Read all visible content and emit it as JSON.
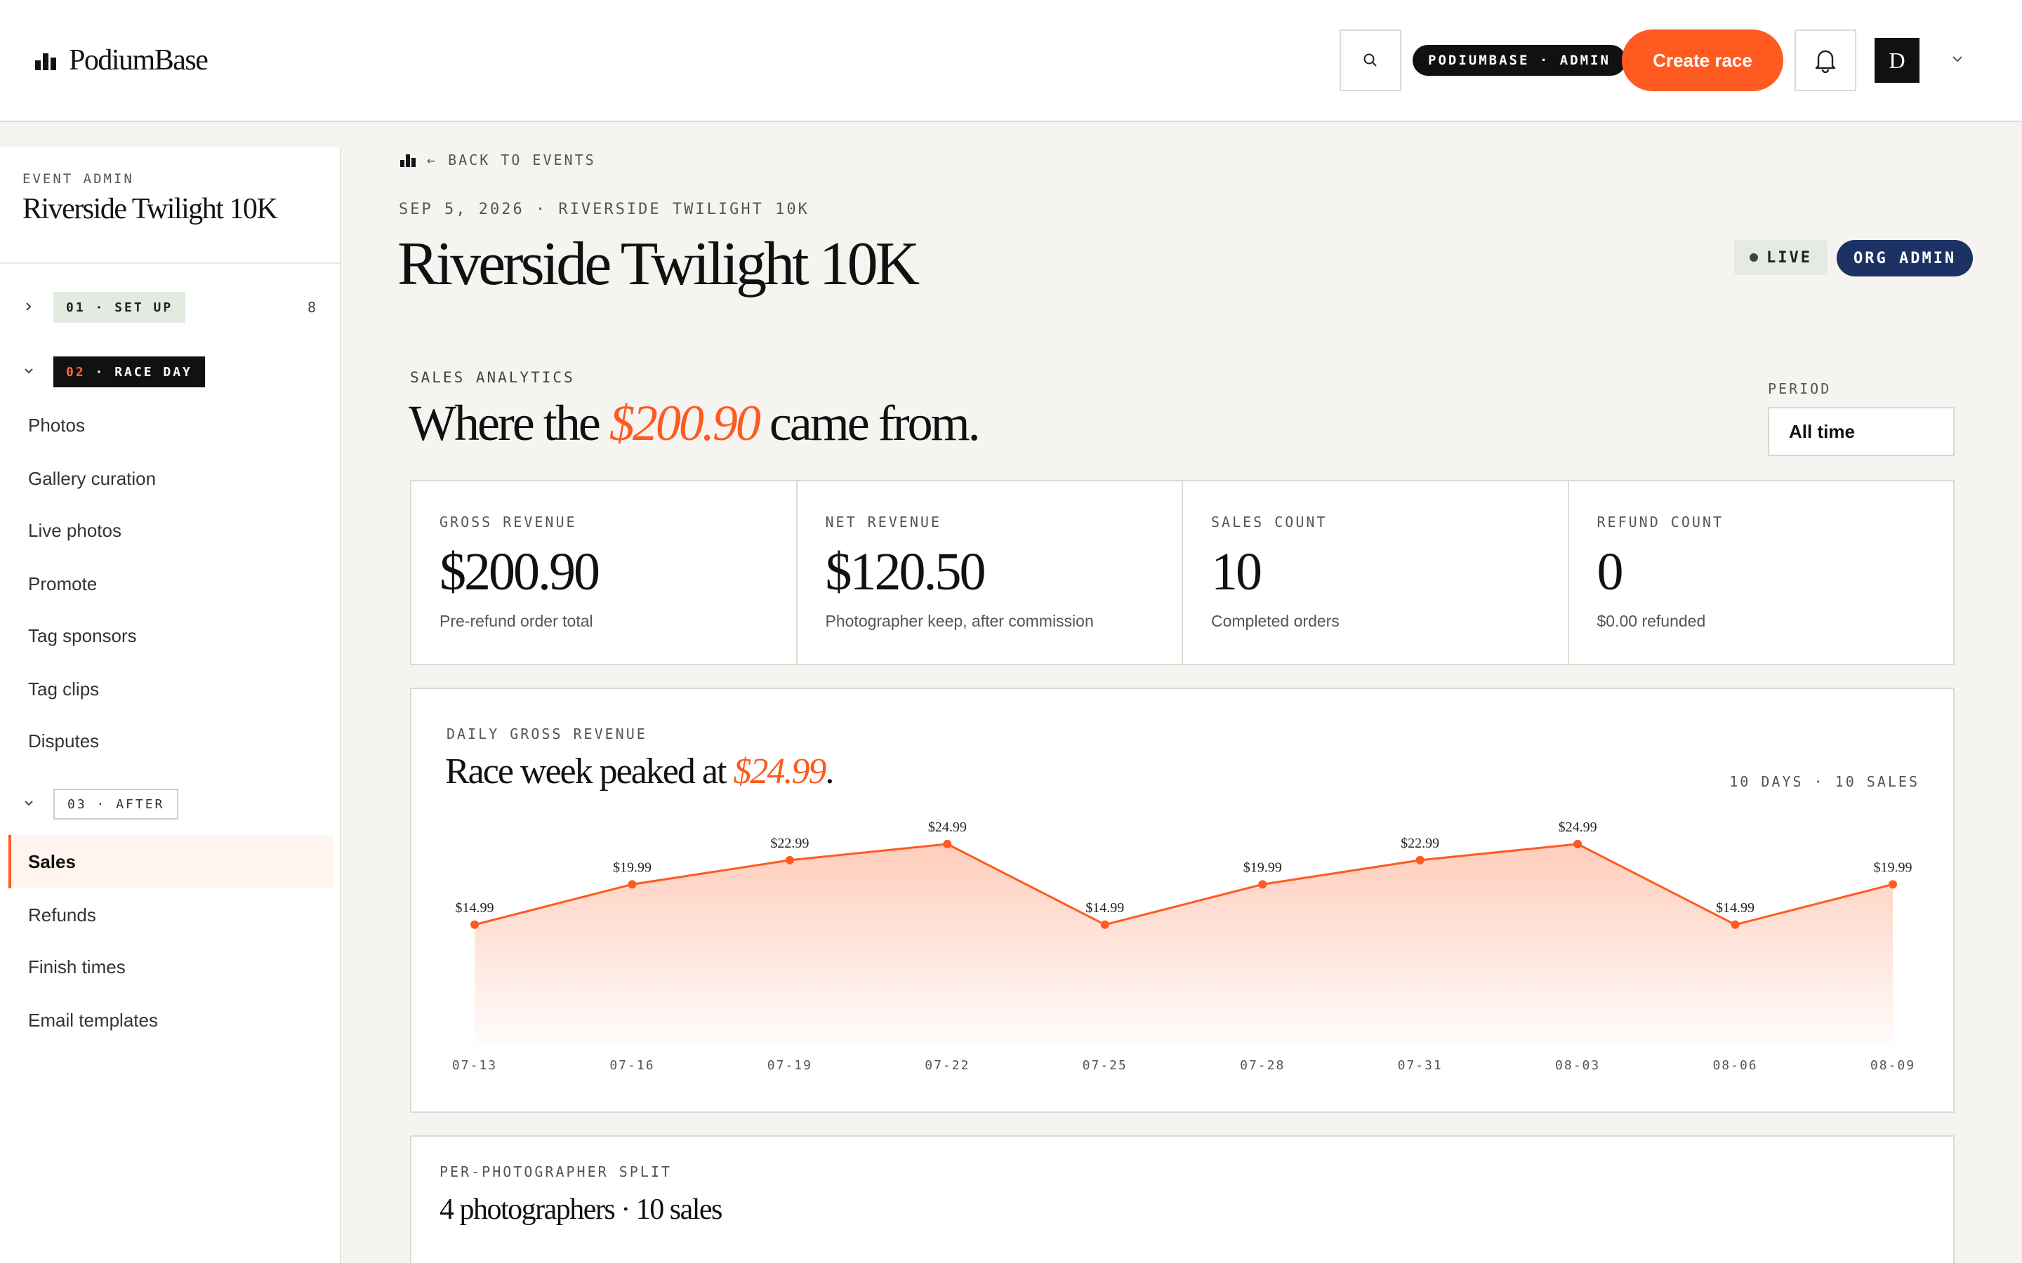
{
  "header": {
    "brand": "PodiumBase",
    "admin_badge": "PODIUMBASE · ADMIN",
    "create_label": "Create race",
    "avatar_initial": "D"
  },
  "sidebar": {
    "kicker": "EVENT ADMIN",
    "title": "Riverside Twilight 10K",
    "groups": [
      {
        "label": "01 · SET UP",
        "num": "01",
        "name": "SET UP",
        "count": "8",
        "expanded": false
      },
      {
        "label": "02 · RACE DAY",
        "num": "02",
        "name": "RACE DAY",
        "expanded": true
      },
      {
        "label": "03 · AFTER",
        "num": "03",
        "name": "AFTER",
        "expanded": true
      }
    ],
    "race_day_items": [
      "Photos",
      "Gallery curation",
      "Live photos",
      "Promote",
      "Tag sponsors",
      "Tag clips",
      "Disputes"
    ],
    "after_items": [
      "Sales",
      "Refunds",
      "Finish times",
      "Email templates"
    ],
    "active_item": "Sales"
  },
  "main": {
    "back_label": "← BACK TO EVENTS",
    "event_meta": "SEP 5, 2026 · RIVERSIDE TWILIGHT 10K",
    "event_title": "Riverside Twilight 10K",
    "live_label": "LIVE",
    "org_admin_label": "ORG ADMIN",
    "sales": {
      "kicker": "SALES ANALYTICS",
      "head_pre": "Where the ",
      "head_amount": "$200.90",
      "head_post": " came from.",
      "period_label": "PERIOD",
      "period_value": "All time"
    },
    "kpis": [
      {
        "label": "GROSS REVENUE",
        "value": "$200.90",
        "sub": "Pre-refund order total"
      },
      {
        "label": "NET REVENUE",
        "value": "$120.50",
        "sub": "Photographer keep, after commission"
      },
      {
        "label": "SALES COUNT",
        "value": "10",
        "sub": "Completed orders"
      },
      {
        "label": "REFUND COUNT",
        "value": "0",
        "sub": "$0.00 refunded"
      }
    ],
    "chart": {
      "kicker": "DAILY GROSS REVENUE",
      "head_pre": "Race week peaked at ",
      "head_amount": "$24.99",
      "head_post": ".",
      "meta": "10 DAYS · 10 SALES"
    },
    "split": {
      "kicker": "PER-PHOTOGRAPHER SPLIT",
      "head": "4 photographers · 10 sales"
    }
  },
  "colors": {
    "accent": "#ff5a1f",
    "org_admin": "#1c3264",
    "live_bg": "#e5ebe2"
  },
  "chart_data": {
    "type": "area",
    "x": [
      "07-13",
      "07-16",
      "07-19",
      "07-22",
      "07-25",
      "07-28",
      "07-31",
      "08-03",
      "08-06",
      "08-09"
    ],
    "values": [
      14.99,
      19.99,
      22.99,
      24.99,
      14.99,
      19.99,
      22.99,
      24.99,
      14.99,
      19.99
    ],
    "data_labels": [
      "$14.99",
      "$19.99",
      "$22.99",
      "$24.99",
      "$14.99",
      "$19.99",
      "$22.99",
      "$24.99",
      "$14.99",
      "$19.99"
    ],
    "ylim": [
      0,
      24.99
    ],
    "grid": false
  }
}
